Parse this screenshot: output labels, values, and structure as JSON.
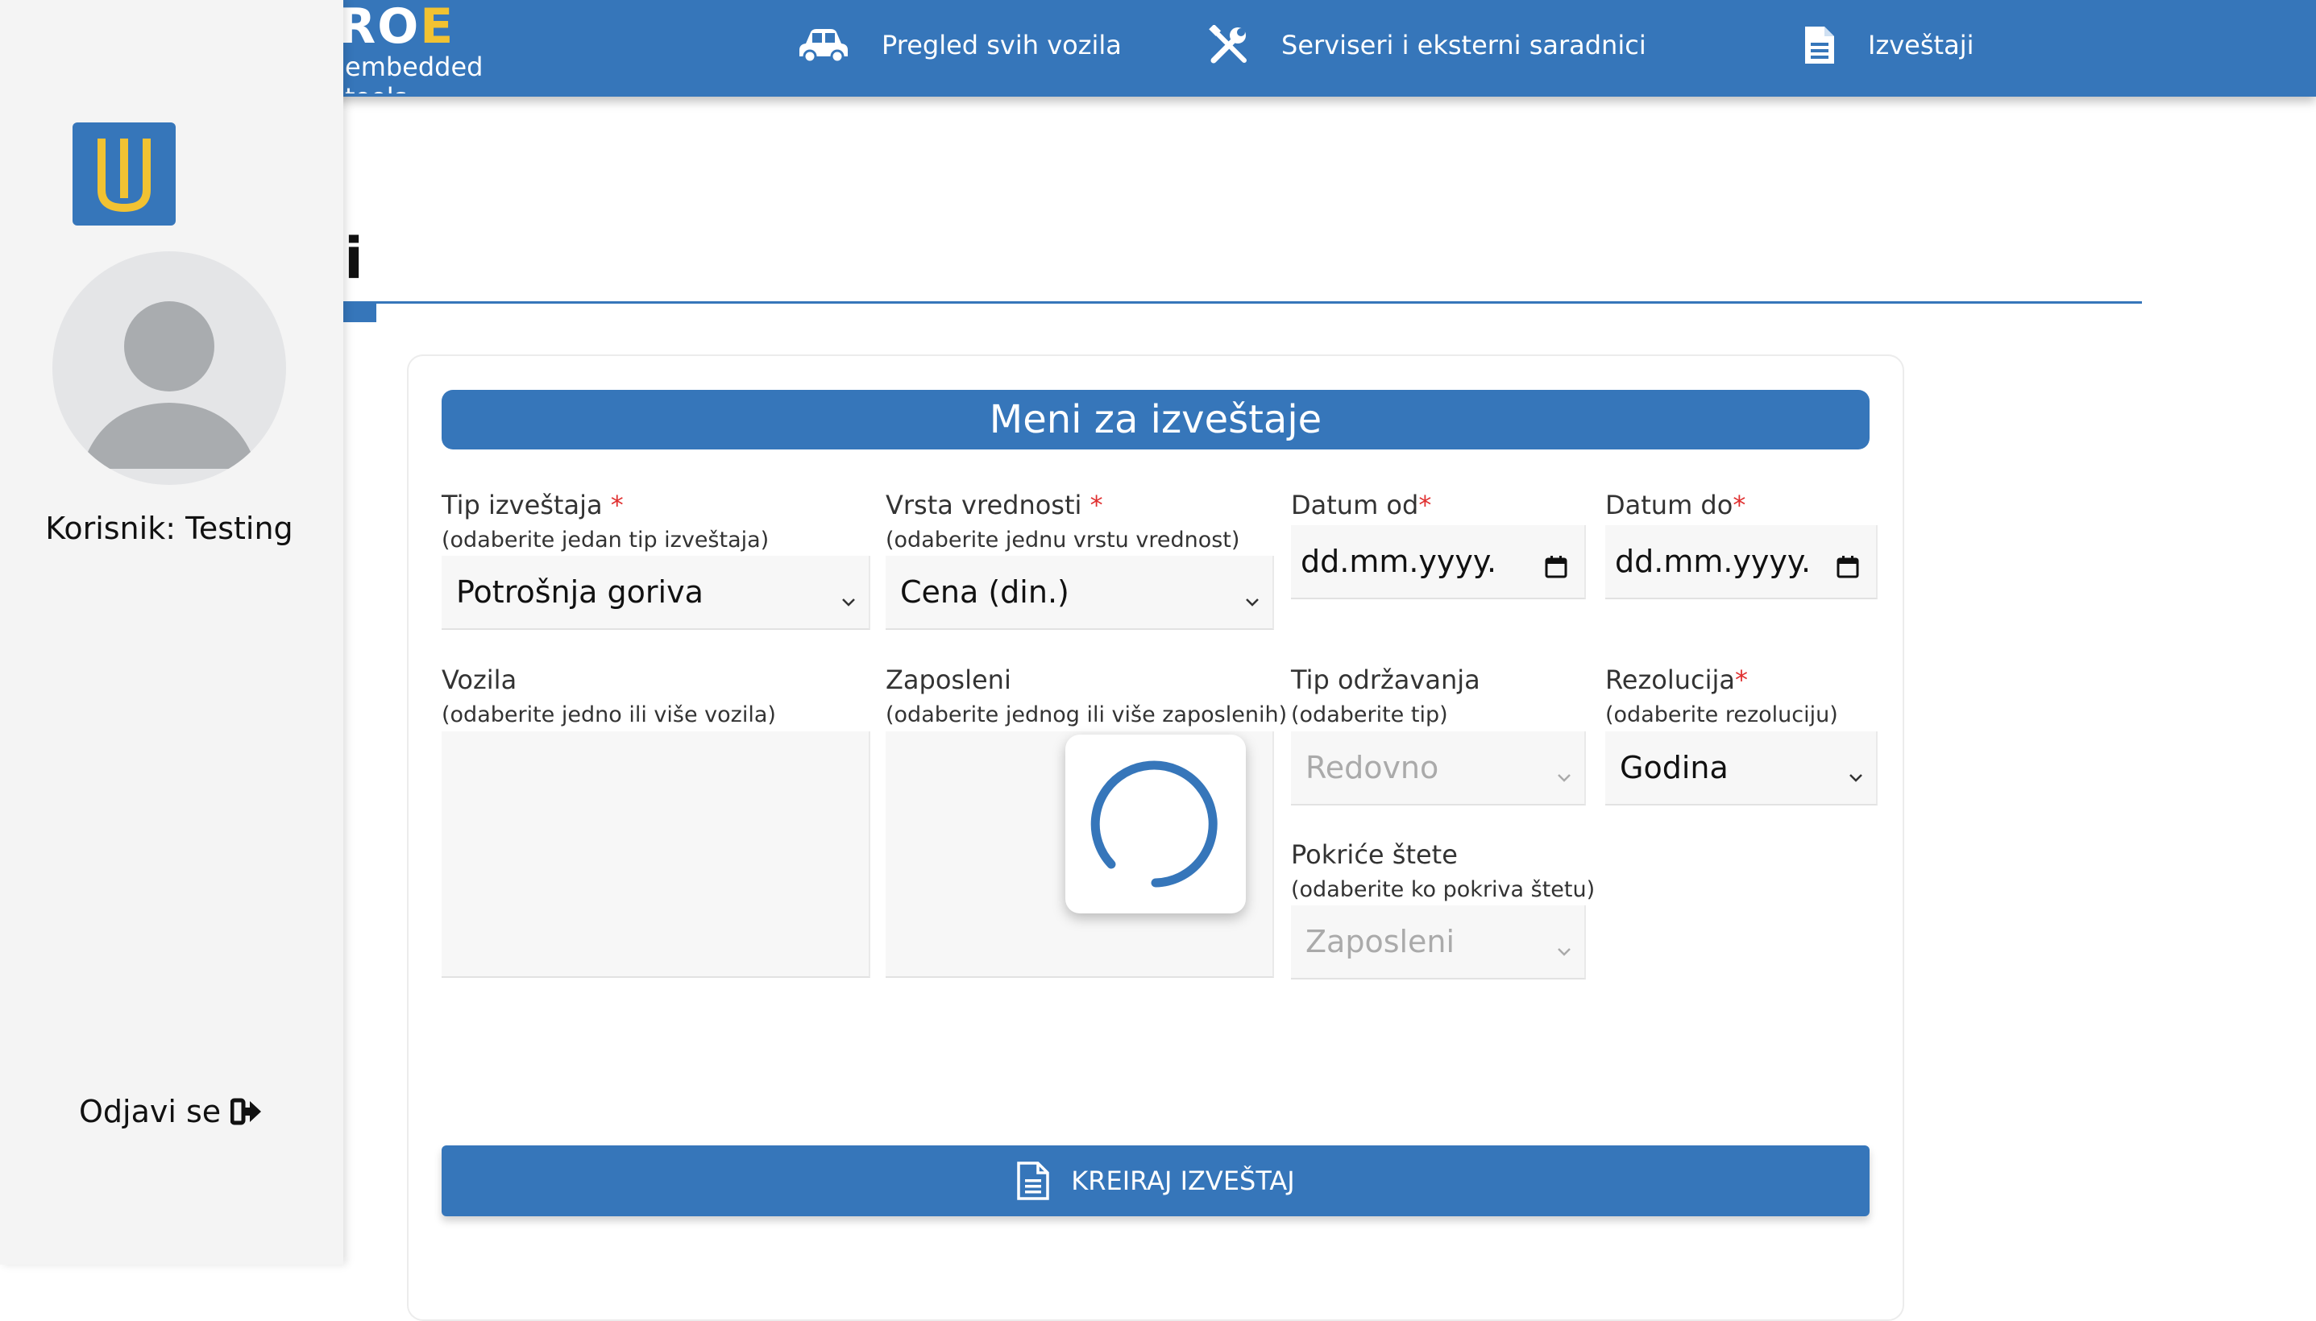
{
  "brand": {
    "logo_main_prefix": "RO",
    "logo_main_accent": "E",
    "logo_sub": "embedded tools"
  },
  "nav": {
    "vehicles": {
      "label": "Pregled svih vozila",
      "icon": "car-icon"
    },
    "service": {
      "label": "Serviseri i eksterni saradnici",
      "icon": "tools-icon"
    },
    "reports": {
      "label": "Izveštaji",
      "icon": "document-icon"
    }
  },
  "page": {
    "heading_visible": "ji"
  },
  "sidebar": {
    "user_label": "Korisnik: Testing",
    "logout_label": "Odjavi se"
  },
  "form": {
    "title": "Meni za izveštaje",
    "report_type": {
      "label": "Tip izveštaja",
      "required": "*",
      "hint": "(odaberite jedan tip izveštaja)",
      "value": "Potrošnja goriva"
    },
    "value_type": {
      "label": "Vrsta vrednosti",
      "required": "*",
      "hint": "(odaberite jednu vrstu vrednost)",
      "value": "Cena (din.)"
    },
    "date_from": {
      "label": "Datum od",
      "required": "*",
      "placeholder": "dd.mm.yyyy."
    },
    "date_to": {
      "label": "Datum do",
      "required": "*",
      "placeholder": "dd.mm.yyyy."
    },
    "vehicles": {
      "label": "Vozila",
      "hint": "(odaberite jedno ili više vozila)"
    },
    "employees": {
      "label": "Zaposleni",
      "hint": "(odaberite jednog ili više zaposlenih)"
    },
    "maintenance_type": {
      "label": "Tip održavanja",
      "hint": "(odaberite tip)",
      "value": "Redovno"
    },
    "resolution": {
      "label": "Rezolucija",
      "required": "*",
      "hint": "(odaberite rezoluciju)",
      "value": "Godina"
    },
    "damage_coverage": {
      "label": "Pokriće štete",
      "hint": "(odaberite ko pokriva štetu)",
      "value": "Zaposleni"
    },
    "submit_label": "KREIRAJ IZVEŠTAJ"
  },
  "colors": {
    "primary": "#3676ba",
    "accent": "#f1c232",
    "required": "#e03030"
  }
}
